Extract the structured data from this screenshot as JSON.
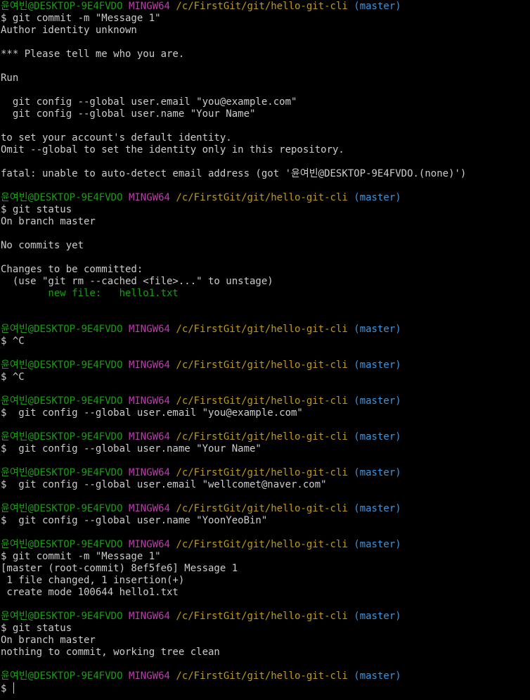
{
  "prompt": {
    "user": "윤여빈@DESKTOP-9E4FVDO",
    "system": "MINGW64",
    "path": "/c/FirstGit/git/hello-git-cli",
    "branch": "(master)"
  },
  "lines": [
    {
      "type": "prompt"
    },
    {
      "type": "text",
      "text": "$ git commit -m \"Message 1\""
    },
    {
      "type": "text",
      "text": "Author identity unknown"
    },
    {
      "type": "blank"
    },
    {
      "type": "text",
      "text": "*** Please tell me who you are."
    },
    {
      "type": "blank"
    },
    {
      "type": "text",
      "text": "Run"
    },
    {
      "type": "blank"
    },
    {
      "type": "text",
      "text": "  git config --global user.email \"you@example.com\""
    },
    {
      "type": "text",
      "text": "  git config --global user.name \"Your Name\""
    },
    {
      "type": "blank"
    },
    {
      "type": "text",
      "text": "to set your account's default identity."
    },
    {
      "type": "text",
      "text": "Omit --global to set the identity only in this repository."
    },
    {
      "type": "blank"
    },
    {
      "type": "text",
      "text": "fatal: unable to auto-detect email address (got '윤여빈@DESKTOP-9E4FVDO.(none)')"
    },
    {
      "type": "blank"
    },
    {
      "type": "prompt"
    },
    {
      "type": "text",
      "text": "$ git status"
    },
    {
      "type": "text",
      "text": "On branch master"
    },
    {
      "type": "blank"
    },
    {
      "type": "text",
      "text": "No commits yet"
    },
    {
      "type": "blank"
    },
    {
      "type": "text",
      "text": "Changes to be committed:"
    },
    {
      "type": "text",
      "text": "  (use \"git rm --cached <file>...\" to unstage)"
    },
    {
      "type": "green",
      "text": "        new file:   hello1.txt"
    },
    {
      "type": "blank"
    },
    {
      "type": "blank"
    },
    {
      "type": "prompt"
    },
    {
      "type": "text",
      "text": "$ ^C"
    },
    {
      "type": "blank"
    },
    {
      "type": "prompt"
    },
    {
      "type": "text",
      "text": "$ ^C"
    },
    {
      "type": "blank"
    },
    {
      "type": "prompt"
    },
    {
      "type": "text",
      "text": "$  git config --global user.email \"you@example.com\""
    },
    {
      "type": "blank"
    },
    {
      "type": "prompt"
    },
    {
      "type": "text",
      "text": "$  git config --global user.name \"Your Name\""
    },
    {
      "type": "blank"
    },
    {
      "type": "prompt"
    },
    {
      "type": "text",
      "text": "$  git config --global user.email \"wellcomet@naver.com\""
    },
    {
      "type": "blank"
    },
    {
      "type": "prompt"
    },
    {
      "type": "text",
      "text": "$  git config --global user.name \"YoonYeoBin\""
    },
    {
      "type": "blank"
    },
    {
      "type": "prompt"
    },
    {
      "type": "text",
      "text": "$ git commit -m \"Message 1\""
    },
    {
      "type": "text",
      "text": "[master (root-commit) 8ef5fe6] Message 1"
    },
    {
      "type": "text",
      "text": " 1 file changed, 1 insertion(+)"
    },
    {
      "type": "text",
      "text": " create mode 100644 hello1.txt"
    },
    {
      "type": "blank"
    },
    {
      "type": "prompt"
    },
    {
      "type": "text",
      "text": "$ git status"
    },
    {
      "type": "text",
      "text": "On branch master"
    },
    {
      "type": "text",
      "text": "nothing to commit, working tree clean"
    },
    {
      "type": "blank"
    },
    {
      "type": "prompt"
    },
    {
      "type": "input",
      "text": "$ "
    }
  ],
  "colors": {
    "background": "#000000",
    "foreground": "#cccccc",
    "user": "#13a10e",
    "system": "#c239b3",
    "path": "#c19c00",
    "branch": "#3a96dd",
    "staged": "#13a10e"
  }
}
